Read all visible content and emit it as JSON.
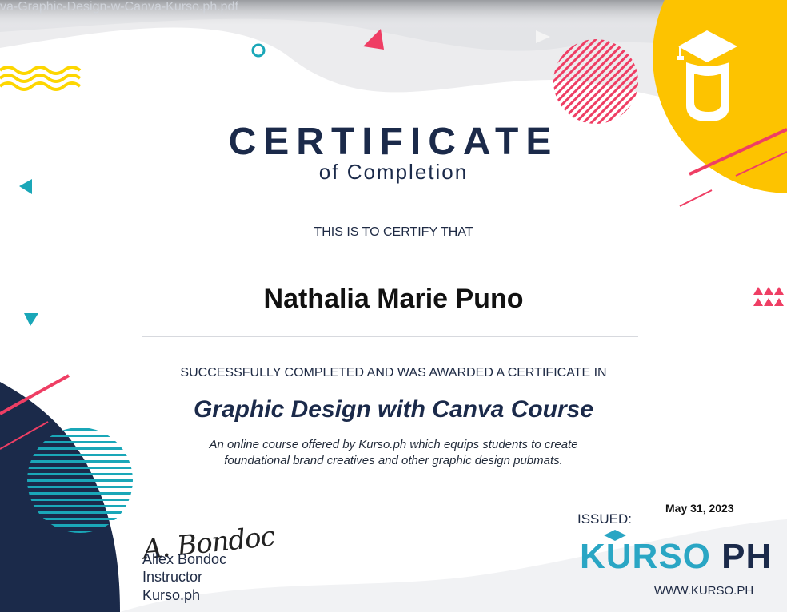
{
  "document": {
    "file_title": "va-Graphic-Design-w-Canva-Kurso.ph.pdf",
    "title": "CERTIFICATE",
    "subtitle": "of Completion",
    "certify_line": "THIS IS TO CERTIFY THAT",
    "recipient": "Nathalia Marie Puno",
    "completed_line": "SUCCESSFULLY COMPLETED AND WAS AWARDED A CERTIFICATE IN",
    "course_name": "Graphic Design with Canva Course",
    "description_line1": "An online course offered by Kurso.ph which equips students to create",
    "description_line2": "foundational brand creatives and other graphic design pubmats."
  },
  "signature": {
    "script": "A. Bondoc",
    "name": "Allex Bondoc",
    "role": "Instructor",
    "org": "Kurso.ph"
  },
  "issued": {
    "label": "ISSUED:",
    "date": "May 31, 2023"
  },
  "brand": {
    "part1": "KURSO",
    "part2": " PH",
    "url": "WWW.KURSO.PH"
  },
  "colors": {
    "navy": "#1b2a4a",
    "yellow": "#fdc300",
    "pink": "#ef3e64",
    "teal": "#1aa7b8"
  },
  "icons": [
    "graduation-cap-logo-icon",
    "mortarboard-icon"
  ]
}
